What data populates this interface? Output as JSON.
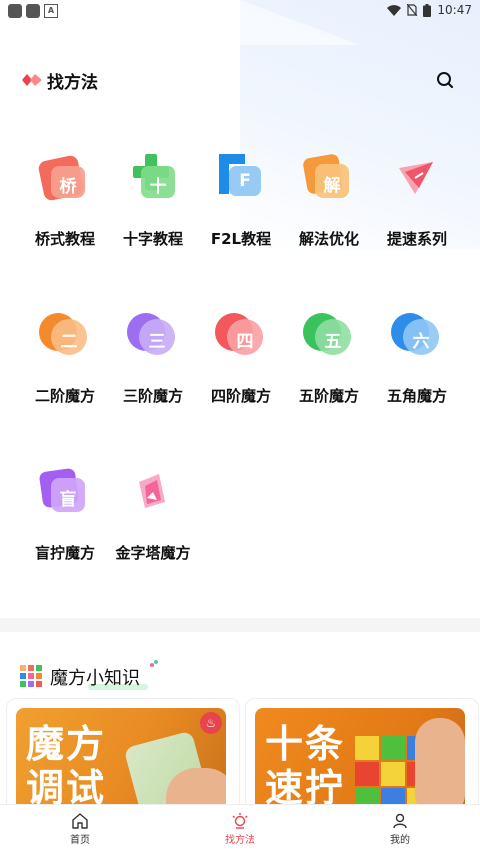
{
  "status_bar": {
    "time": "10:47",
    "icons": [
      "notification-icon",
      "notification-icon",
      "a-icon",
      "wifi-icon",
      "no-sim-icon",
      "battery-icon"
    ]
  },
  "header": {
    "title": "找方法",
    "logo_icon": "cube-logo-icon",
    "search_icon": "search-icon"
  },
  "methods": [
    {
      "label": "桥式教程",
      "glyph": "桥",
      "icon": "bridge-tutorial-icon",
      "color": "#f26b5b"
    },
    {
      "label": "十字教程",
      "glyph": "十",
      "icon": "cross-tutorial-icon",
      "color": "#3fc25b"
    },
    {
      "label": "F2L教程",
      "glyph": "F",
      "icon": "f2l-tutorial-icon",
      "color": "#1e8ce8"
    },
    {
      "label": "解法优化",
      "glyph": "解",
      "icon": "solution-optimize-icon",
      "color": "#f59a3b"
    },
    {
      "label": "提速系列",
      "glyph": "",
      "icon": "paper-plane-icon",
      "color": "#f1556c"
    },
    {
      "label": "二阶魔方",
      "glyph": "二",
      "icon": "cube-2x2-icon",
      "color": "#f5892e"
    },
    {
      "label": "三阶魔方",
      "glyph": "三",
      "icon": "cube-3x3-icon",
      "color": "#9b6ef2"
    },
    {
      "label": "四阶魔方",
      "glyph": "四",
      "icon": "cube-4x4-icon",
      "color": "#f2585c"
    },
    {
      "label": "五阶魔方",
      "glyph": "五",
      "icon": "cube-5x5-icon",
      "color": "#3ac25d"
    },
    {
      "label": "五角魔方",
      "glyph": "六",
      "icon": "megaminx-icon",
      "color": "#2d8de8"
    },
    {
      "label": "盲拧魔方",
      "glyph": "盲",
      "icon": "blindfold-icon",
      "color": "#a25ff0"
    },
    {
      "label": "金字塔魔方",
      "glyph": "",
      "icon": "pyraminx-icon",
      "color": "#f3669a"
    }
  ],
  "knowledge": {
    "title": "魔方小知识",
    "cards": [
      {
        "text": "魔方\n调试",
        "badge_icon": "fire-icon"
      },
      {
        "text": "十条\n速拧"
      }
    ]
  },
  "bottom_nav": [
    {
      "label": "首页",
      "icon": "home-icon",
      "active": false
    },
    {
      "label": "找方法",
      "icon": "bulb-icon",
      "active": true
    },
    {
      "label": "我的",
      "icon": "user-icon",
      "active": false
    }
  ],
  "colors": {
    "accent": "#e8444b",
    "text": "#111111"
  }
}
